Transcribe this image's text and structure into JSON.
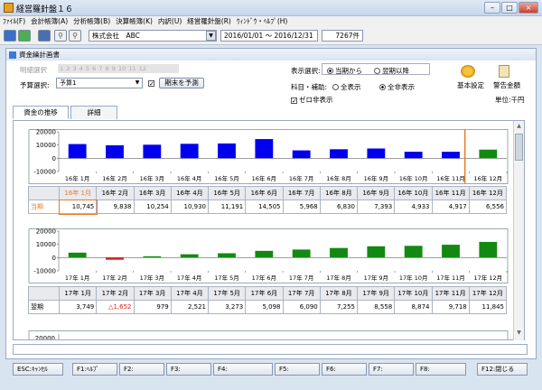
{
  "window": {
    "title": "経営羅針盤１６",
    "min": "–",
    "max": "□",
    "close": "×"
  },
  "menu": [
    "ﾌｧｲﾙ(F)",
    "会計帳簿(A)",
    "分析帳簿(B)",
    "決算帳簿(K)",
    "内訳(U)",
    "経営羅針盤(R)",
    "ｳｨﾝﾄﾞｳ・ﾍﾙﾌﾟ(H)"
  ],
  "toolbar": {
    "company": "株式会社　ABC",
    "period": "2016/01/01 〜 2016/12/31",
    "count": "7267件"
  },
  "doc": {
    "title": "資金繰計画書"
  },
  "controls": {
    "month_select_label": "明細選択",
    "month_numbers": [
      "1",
      "2",
      "3",
      "4",
      "5",
      "6",
      "7",
      "8",
      "9",
      "10",
      "11",
      "12"
    ],
    "budget_label": "予算選択:",
    "budget_value": "予算1",
    "predict_button": "期末を予測",
    "display_label": "表示選択:",
    "display_opt1": "当期から",
    "display_opt2": "翌期以降",
    "subject_label": "科目・補助:",
    "subject_opt1": "全表示",
    "subject_opt2": "全非表示",
    "zero_hide": "ゼロ非表示",
    "basic_settings": "基本設定",
    "warning_amount": "警告金額",
    "unit": "単位:千円"
  },
  "tabs": [
    "資金の推移",
    "詳細"
  ],
  "colors": {
    "positive": "#0000ee",
    "forecast": "#128a12",
    "negative": "#e02020",
    "highlight": "#e87a2a"
  },
  "chart_data": [
    {
      "type": "bar",
      "categories": [
        "16年 1月",
        "16年 2月",
        "16年 3月",
        "16年 4月",
        "16年 5月",
        "16年 6月",
        "16年 7月",
        "16年 8月",
        "16年 9月",
        "16年 10月",
        "16年 11月",
        "16年 12月"
      ],
      "values": [
        10745,
        9838,
        10254,
        10930,
        11191,
        14505,
        5968,
        6830,
        7393,
        4933,
        4917,
        6556
      ],
      "yticks": [
        "20000",
        "10000",
        "0",
        "-10000"
      ],
      "ylim": [
        -10000,
        20000
      ]
    },
    {
      "type": "bar",
      "categories": [
        "17年 1月",
        "17年 2月",
        "17年 3月",
        "17年 4月",
        "17年 5月",
        "17年 6月",
        "17年 7月",
        "17年 8月",
        "17年 9月",
        "17年 10月",
        "17年 11月",
        "17年 12月"
      ],
      "values": [
        3749,
        -1652,
        979,
        2521,
        3273,
        5098,
        6090,
        7255,
        8558,
        8874,
        9718,
        11845
      ],
      "yticks": [
        "20000",
        "10000",
        "0",
        "-10000"
      ],
      "ylim": [
        -10000,
        20000
      ]
    }
  ],
  "table1": {
    "row_label": "当期",
    "cells": [
      "10,745",
      "9,838",
      "10,254",
      "10,930",
      "11,191",
      "14,505",
      "5,968",
      "6,830",
      "7,393",
      "4,933",
      "4,917",
      "6,556"
    ]
  },
  "table2": {
    "row_label": "翌期",
    "cells": [
      "3,749",
      "△1,652",
      "979",
      "2,521",
      "3,273",
      "5,098",
      "6,090",
      "7,255",
      "8,558",
      "8,874",
      "9,718",
      "11,845"
    ]
  },
  "chart3": {
    "ytick": "20000"
  },
  "fkeys": [
    "ESC:ｷｬﾝｾﾙ",
    "F1:ﾍﾙﾌﾟ",
    "F2:",
    "F3:",
    "F4:",
    "F5:",
    "F6:",
    "F7:",
    "F8:",
    "F12:閉じる"
  ]
}
